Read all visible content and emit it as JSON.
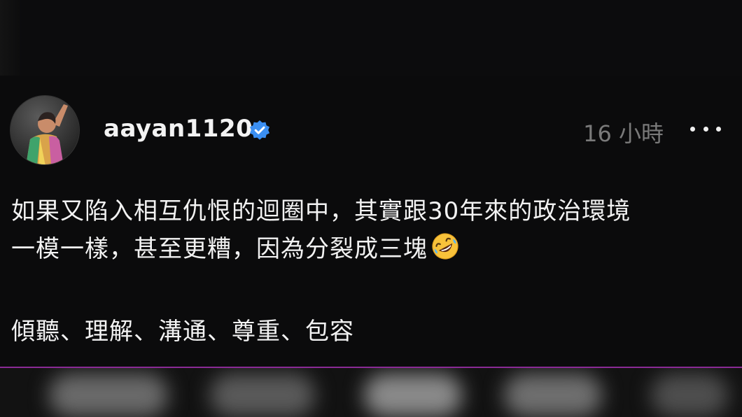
{
  "post": {
    "username": "aayan1120",
    "timestamp": "16 小時",
    "lines": [
      "如果又陷入相互仇恨的迴圈中，其實跟30年來的政治環境",
      "一模一樣，甚至更糟，因為分裂成三塊",
      "傾聽、理解、溝通、尊重、包容"
    ],
    "emoji": "rolling-on-floor-laughing-emoji"
  },
  "icons": {
    "verified": "verified-badge-icon",
    "more": "more-options-icon"
  },
  "colors": {
    "background": "#0b0b0c",
    "text": "#f2f2f2",
    "timestamp": "#7a7a7a",
    "verified": "#3b8ff3",
    "divider": "#8a2a96"
  }
}
